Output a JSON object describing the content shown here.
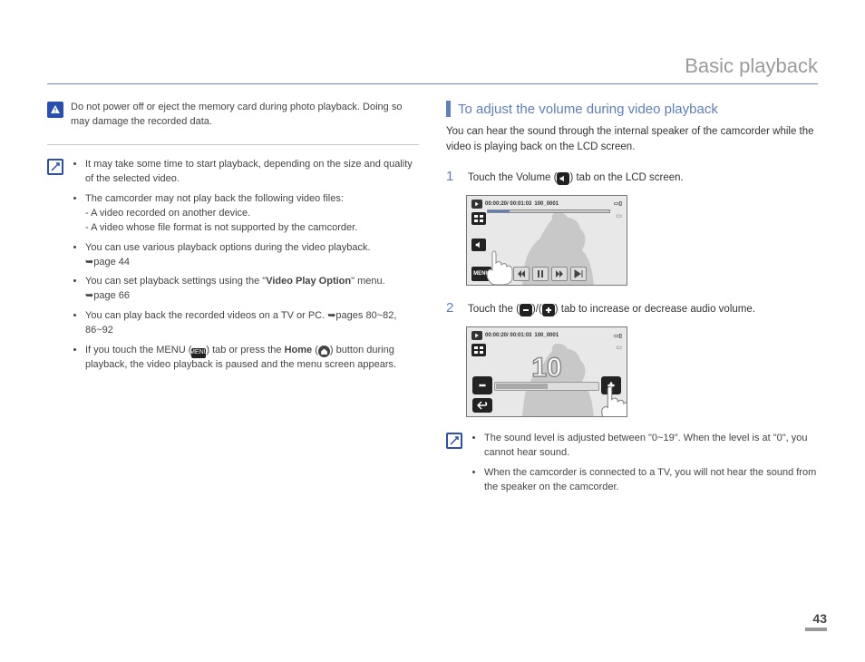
{
  "page": {
    "title": "Basic playback",
    "number": "43"
  },
  "left": {
    "warning": "Do not power off or eject the memory card during photo playback. Doing so may damage the recorded data.",
    "notes": [
      {
        "text": "It may take some time to start playback, depending on the size and quality of the selected video."
      },
      {
        "text": "The camcorder may not play back the following video files:",
        "sub": [
          "- A video recorded on another device.",
          "- A video whose file format is not supported by the camcorder."
        ]
      },
      {
        "text": "You can use various playback options during the video playback. ",
        "ref": "➥page 44"
      },
      {
        "prefix": "You can set playback settings using the \"",
        "bold": "Video Play Option",
        "suffix": "\" menu. ",
        "ref": "➥page 66"
      },
      {
        "text": "You can play back the recorded videos on a TV or PC. ",
        "ref": "➥pages 80~82, 86~92"
      },
      {
        "menu_pre": "If you touch the MENU (",
        "menu_label": "MENU",
        "menu_mid": ") tab or press the ",
        "home_bold": "Home",
        "menu_home_pre": " (",
        "menu_post": ") button during playback, the video playback is paused and  the menu screen appears."
      }
    ]
  },
  "right": {
    "section_title": "To adjust the volume during video playback",
    "intro": "You can hear the sound through the internal speaker of the camcorder while the video is playing back on the LCD screen.",
    "step1": {
      "pre": "Touch the Volume (",
      "post": ") tab on the LCD screen."
    },
    "step2": {
      "pre": "Touch the (",
      "mid": ")/(",
      "post": ") tab to increase or decrease audio volume."
    },
    "lcd1": {
      "time": "00:00:20/ 00:01:03",
      "file": "100_0001",
      "menu": "MENU"
    },
    "lcd2": {
      "time": "00:00:20/ 00:01:03",
      "file": "100_0001",
      "level": "10"
    },
    "notes": [
      "The sound level is adjusted between \"0~19\". When the level is at \"0\", you cannot hear sound.",
      "When the camcorder is connected to a TV, you will not hear the sound from the speaker on the camcorder."
    ]
  }
}
